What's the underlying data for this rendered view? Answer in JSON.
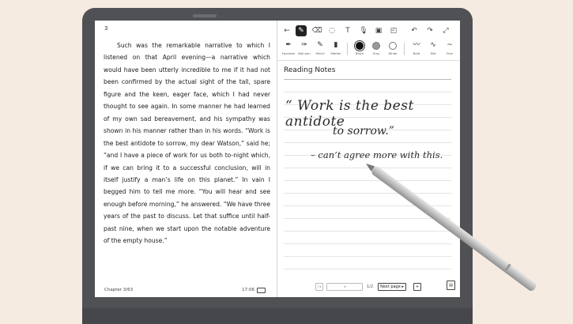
{
  "book": {
    "page_number": "3",
    "text": "Such was the remarkable narrative to which I listened on that April evening—a narrative which would have been utterly incredible to me if it had not been confirmed by the actual sight of the tall, spare figure and the keen, eager face, which I had never thought to see again. In some manner he had learned of my own sad bereavement, and his sympathy was shown in his manner rather than in his words. “Work is the best antidote to sorrow, my dear Watson,” said he; “and I have a piece of work for us both to-night which, if we can bring it to a successful conclusion, will in itself justify a man’s life on this planet.” In vain I begged him to tell me more. “You will hear and see enough before morning,” he answered. “We have three years of the past to discuss. Let that suffice until half-past nine, when we start upon the notable adventure of the empty house.”",
    "chapter": "Chapter 3/63",
    "time": "17:06"
  },
  "notes": {
    "title": "Reading Notes",
    "handwriting": {
      "line1": "“ Work is the best antidote",
      "line2": "to sorrow.”",
      "line3": "– can’t agree more with this."
    },
    "pen_tools": [
      {
        "name": "pen-tool-fountain",
        "icon": "✒",
        "label": "Fountain"
      },
      {
        "name": "pen-tool-ballpen",
        "icon": "🖊",
        "label": "Ball pen"
      },
      {
        "name": "pen-tool-pencil",
        "icon": "✎",
        "label": "Pencil"
      },
      {
        "name": "pen-tool-marker",
        "icon": "▮",
        "label": "Marker"
      }
    ],
    "colors": [
      {
        "name": "color-black",
        "label": "Black",
        "fill": "#111111"
      },
      {
        "name": "color-gray",
        "label": "Gray",
        "fill": "#9a9a9a"
      },
      {
        "name": "color-white",
        "label": "White",
        "fill": "#ffffff"
      }
    ],
    "widths": [
      {
        "name": "width-bold",
        "icon": "〰",
        "label": "Bold"
      },
      {
        "name": "width-mid",
        "icon": "∿",
        "label": "Mid"
      },
      {
        "name": "width-fine",
        "icon": "~",
        "label": "Fine"
      }
    ],
    "pager": {
      "count": "1/2",
      "next_label": "Next page ▸",
      "add_label": "+"
    }
  },
  "colors": {
    "background": "#f5ebe0",
    "device": "#4f5155",
    "stylus": "#c9c9c9"
  }
}
